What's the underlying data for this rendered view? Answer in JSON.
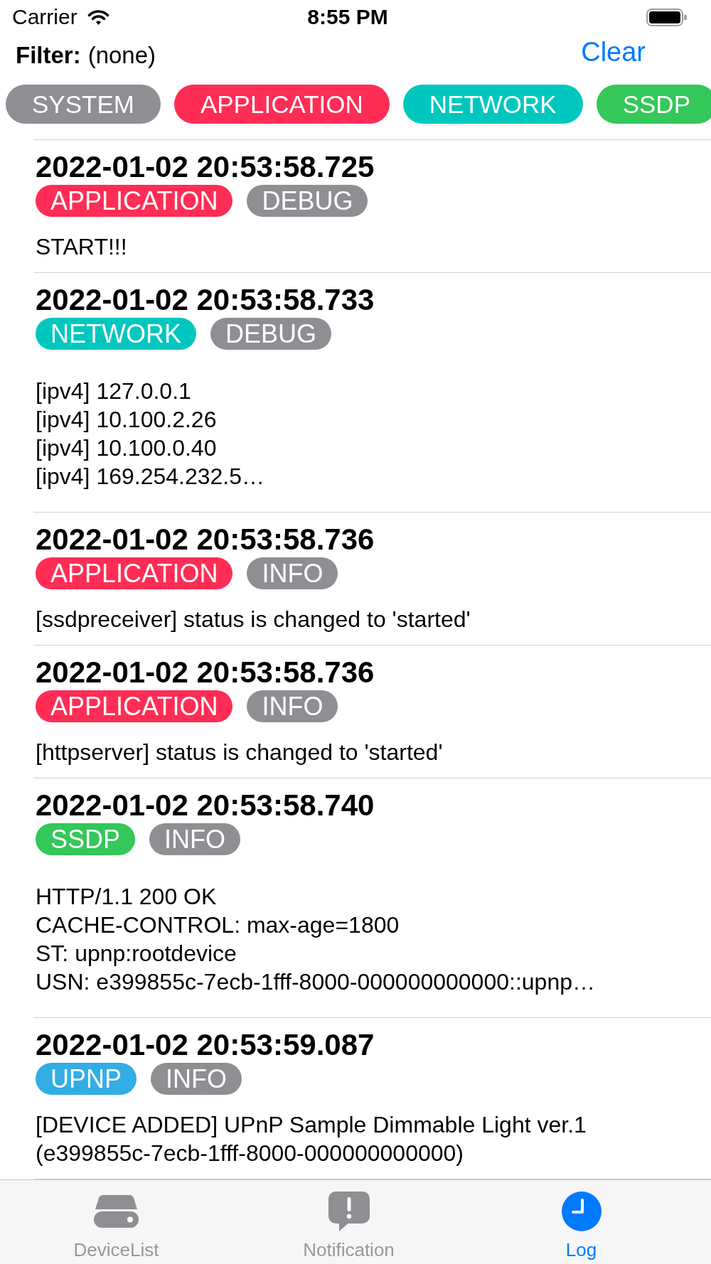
{
  "status_bar": {
    "carrier": "Carrier",
    "time": "8:55 PM"
  },
  "filter": {
    "label": "Filter:",
    "value": "(none)",
    "clear_button": "Clear"
  },
  "categories": [
    {
      "label": "SYSTEM",
      "color": "#8e8e93"
    },
    {
      "label": "APPLICATION",
      "color": "#ff2d55"
    },
    {
      "label": "NETWORK",
      "color": "#00c7be"
    },
    {
      "label": "SSDP",
      "color": "#34c759"
    }
  ],
  "log_entries": [
    {
      "timestamp": "2022-01-02 20:53:58.725",
      "tags": [
        {
          "label": "APPLICATION",
          "color": "#ff2d55"
        },
        {
          "label": "DEBUG",
          "color": "#8e8e93"
        }
      ],
      "message": "START!!!"
    },
    {
      "timestamp": "2022-01-02 20:53:58.733",
      "tags": [
        {
          "label": "NETWORK",
          "color": "#00c7be"
        },
        {
          "label": "DEBUG",
          "color": "#8e8e93"
        }
      ],
      "message": "[ipv4] 127.0.0.1\n[ipv4] 10.100.2.26\n[ipv4] 10.100.0.40\n[ipv4] 169.254.232.5…"
    },
    {
      "timestamp": "2022-01-02 20:53:58.736",
      "tags": [
        {
          "label": "APPLICATION",
          "color": "#ff2d55"
        },
        {
          "label": "INFO",
          "color": "#8e8e93"
        }
      ],
      "message": "[ssdpreceiver] status is changed to 'started'"
    },
    {
      "timestamp": "2022-01-02 20:53:58.736",
      "tags": [
        {
          "label": "APPLICATION",
          "color": "#ff2d55"
        },
        {
          "label": "INFO",
          "color": "#8e8e93"
        }
      ],
      "message": "[httpserver] status is changed to 'started'"
    },
    {
      "timestamp": "2022-01-02 20:53:58.740",
      "tags": [
        {
          "label": "SSDP",
          "color": "#34c759"
        },
        {
          "label": "INFO",
          "color": "#8e8e93"
        }
      ],
      "message": "HTTP/1.1 200 OK\nCACHE-CONTROL: max-age=1800\nST: upnp:rootdevice\nUSN: e399855c-7ecb-1fff-8000-000000000000::upnp…"
    },
    {
      "timestamp": "2022-01-02 20:53:59.087",
      "tags": [
        {
          "label": "UPNP",
          "color": "#32ade6"
        },
        {
          "label": "INFO",
          "color": "#8e8e93"
        }
      ],
      "message": "[DEVICE ADDED] UPnP Sample Dimmable Light ver.1 (e399855c-7ecb-1fff-8000-000000000000)"
    }
  ],
  "tab_bar": {
    "tabs": [
      {
        "label": "DeviceList",
        "selected": false
      },
      {
        "label": "Notification",
        "selected": false
      },
      {
        "label": "Log",
        "selected": true
      }
    ]
  }
}
